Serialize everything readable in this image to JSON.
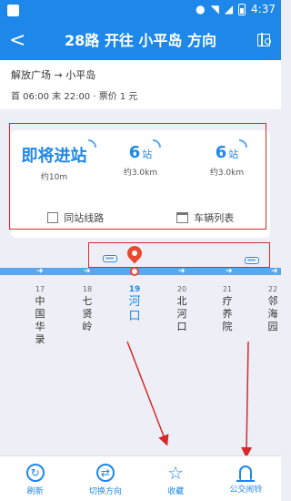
{
  "status": {
    "time": "4:37"
  },
  "header": {
    "title": "28路 开往 小平岛 方向"
  },
  "route": {
    "path": "解放广场 → 小平岛",
    "hours": "首 06:00 末 22:00 · 票价 1 元"
  },
  "arrivals": [
    {
      "main": "即将进站",
      "unit": "",
      "sub": "约10m"
    },
    {
      "main": "6",
      "unit": "站",
      "sub": "约3.0km"
    },
    {
      "main": "6",
      "unit": "站",
      "sub": "约3.0km"
    }
  ],
  "links": {
    "same_stop": "同站线路",
    "vehicles": "车辆列表"
  },
  "stations": [
    {
      "num": "17",
      "name": "中国华录"
    },
    {
      "num": "18",
      "name": "七贤岭"
    },
    {
      "num": "19",
      "name": "河口"
    },
    {
      "num": "20",
      "name": "北河口"
    },
    {
      "num": "21",
      "name": "疗养院"
    },
    {
      "num": "22",
      "name": "邻海园"
    }
  ],
  "tabs": {
    "refresh": "刷新",
    "switch": "切换方向",
    "favorite": "收藏",
    "alarm": "公交闹铃"
  },
  "colors": {
    "accent": "#1e88ea",
    "highlight": "#d62a2a",
    "marker": "#e9492f"
  }
}
